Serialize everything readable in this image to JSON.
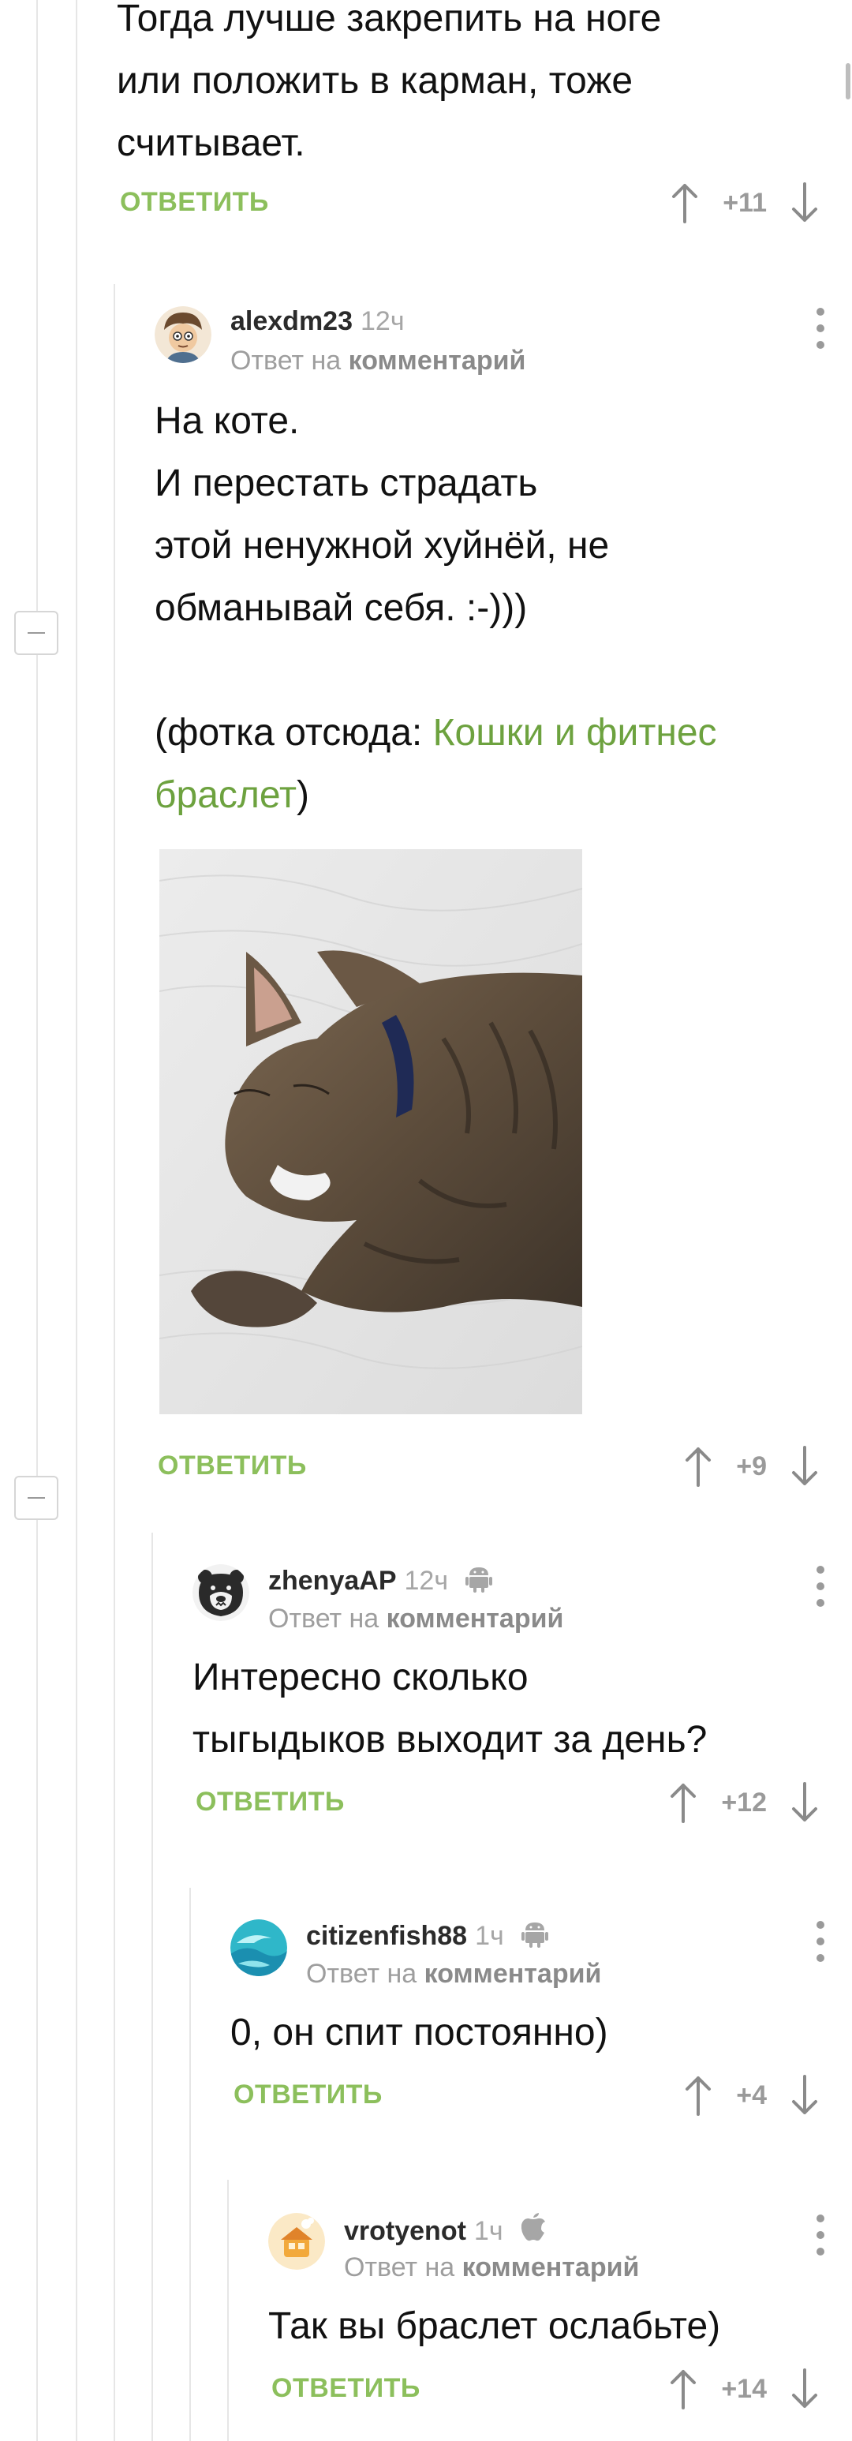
{
  "comments": {
    "c0": {
      "text": "Тогда лучше закрепить на ноге\nили положить в карман, тоже\nсчитывает.",
      "reply_label": "ОТВЕТИТЬ",
      "rating": "+11"
    },
    "c1": {
      "username": "alexdm23",
      "time": "12ч",
      "reply_prefix": "Ответ на",
      "reply_target": "комментарий",
      "text": "На коте.\nИ перестать страдать\nэтой ненужной хуйнёй, не\nобманывай себя. :-)))\n\n(фотка отсюда: ",
      "link_text": "Кошки и фитнес\nбраслет",
      "text_end": ")",
      "reply_label": "ОТВЕТИТЬ",
      "rating": "+9"
    },
    "c2": {
      "username": "zhenyaAP",
      "time": "12ч",
      "platform_icon": "android-icon",
      "reply_prefix": "Ответ на",
      "reply_target": "комментарий",
      "text": "Интересно сколько\nтыгыдыков выходит за день?",
      "reply_label": "ОТВЕТИТЬ",
      "rating": "+12"
    },
    "c3": {
      "username": "citizenfish88",
      "time": "1ч",
      "platform_icon": "android-icon",
      "reply_prefix": "Ответ на",
      "reply_target": "комментарий",
      "text": "0, он спит постоянно)",
      "reply_label": "ОТВЕТИТЬ",
      "rating": "+4"
    },
    "c4": {
      "username": "vrotyenot",
      "time": "1ч",
      "platform_icon": "apple-icon",
      "reply_prefix": "Ответ на",
      "reply_target": "комментарий",
      "text": "Так вы браслет ослабьте)",
      "reply_label": "ОТВЕТИТЬ",
      "rating": "+14"
    }
  },
  "colors": {
    "accent_green": "#6da23f",
    "reply_green": "#8cbf5c",
    "muted_gray": "#9a9a9a",
    "thread_line": "#e6e6e6"
  }
}
